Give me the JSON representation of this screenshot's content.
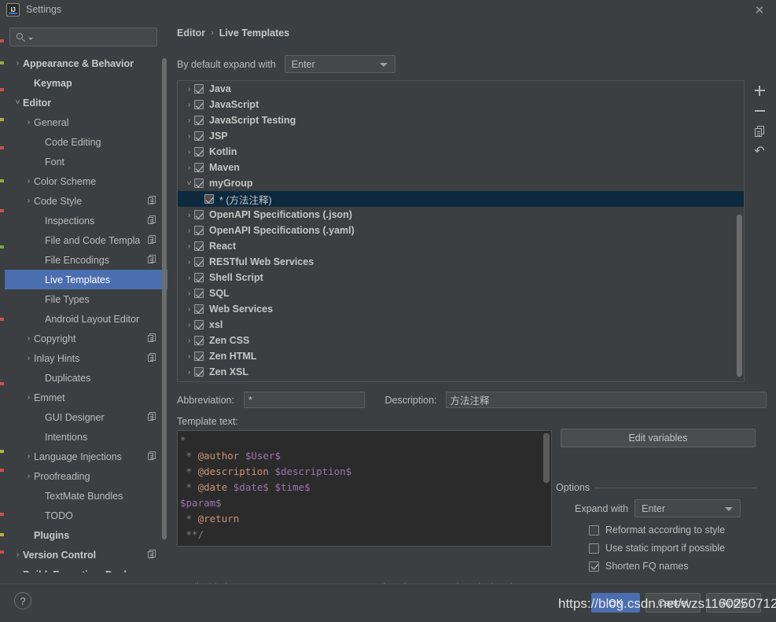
{
  "window": {
    "title": "Settings",
    "logo_text": "IJ",
    "close_icon": "close-icon"
  },
  "sidebar": {
    "search": {
      "placeholder": "",
      "value": "",
      "icon": "search-icon"
    },
    "items": [
      {
        "label": "Appearance & Behavior",
        "arrow": "›",
        "bold": true,
        "indent": 0,
        "copy": false,
        "selected": false
      },
      {
        "label": "Keymap",
        "arrow": "",
        "bold": true,
        "indent": 1,
        "copy": false,
        "selected": false
      },
      {
        "label": "Editor",
        "arrow": "˅",
        "bold": true,
        "indent": 0,
        "copy": false,
        "selected": false
      },
      {
        "label": "General",
        "arrow": "›",
        "bold": false,
        "indent": 1,
        "copy": false,
        "selected": false
      },
      {
        "label": "Code Editing",
        "arrow": "",
        "bold": false,
        "indent": 2,
        "copy": false,
        "selected": false
      },
      {
        "label": "Font",
        "arrow": "",
        "bold": false,
        "indent": 2,
        "copy": false,
        "selected": false
      },
      {
        "label": "Color Scheme",
        "arrow": "›",
        "bold": false,
        "indent": 1,
        "copy": false,
        "selected": false
      },
      {
        "label": "Code Style",
        "arrow": "›",
        "bold": false,
        "indent": 1,
        "copy": true,
        "selected": false
      },
      {
        "label": "Inspections",
        "arrow": "",
        "bold": false,
        "indent": 2,
        "copy": true,
        "selected": false
      },
      {
        "label": "File and Code Templa",
        "arrow": "",
        "bold": false,
        "indent": 2,
        "copy": true,
        "selected": false
      },
      {
        "label": "File Encodings",
        "arrow": "",
        "bold": false,
        "indent": 2,
        "copy": true,
        "selected": false
      },
      {
        "label": "Live Templates",
        "arrow": "",
        "bold": false,
        "indent": 2,
        "copy": false,
        "selected": true
      },
      {
        "label": "File Types",
        "arrow": "",
        "bold": false,
        "indent": 2,
        "copy": false,
        "selected": false
      },
      {
        "label": "Android Layout Editor",
        "arrow": "",
        "bold": false,
        "indent": 2,
        "copy": false,
        "selected": false
      },
      {
        "label": "Copyright",
        "arrow": "›",
        "bold": false,
        "indent": 1,
        "copy": true,
        "selected": false
      },
      {
        "label": "Inlay Hints",
        "arrow": "›",
        "bold": false,
        "indent": 1,
        "copy": true,
        "selected": false
      },
      {
        "label": "Duplicates",
        "arrow": "",
        "bold": false,
        "indent": 2,
        "copy": false,
        "selected": false
      },
      {
        "label": "Emmet",
        "arrow": "›",
        "bold": false,
        "indent": 1,
        "copy": false,
        "selected": false
      },
      {
        "label": "GUI Designer",
        "arrow": "",
        "bold": false,
        "indent": 2,
        "copy": true,
        "selected": false
      },
      {
        "label": "Intentions",
        "arrow": "",
        "bold": false,
        "indent": 2,
        "copy": false,
        "selected": false
      },
      {
        "label": "Language Injections",
        "arrow": "›",
        "bold": false,
        "indent": 1,
        "copy": true,
        "selected": false
      },
      {
        "label": "Proofreading",
        "arrow": "›",
        "bold": false,
        "indent": 1,
        "copy": false,
        "selected": false
      },
      {
        "label": "TextMate Bundles",
        "arrow": "",
        "bold": false,
        "indent": 2,
        "copy": false,
        "selected": false
      },
      {
        "label": "TODO",
        "arrow": "",
        "bold": false,
        "indent": 2,
        "copy": false,
        "selected": false
      },
      {
        "label": "Plugins",
        "arrow": "",
        "bold": true,
        "indent": 1,
        "copy": false,
        "selected": false
      },
      {
        "label": "Version Control",
        "arrow": "›",
        "bold": true,
        "indent": 0,
        "copy": true,
        "selected": false
      },
      {
        "label": "Build, Execution, Deploym",
        "arrow": "›",
        "bold": true,
        "indent": 0,
        "copy": false,
        "selected": false
      }
    ]
  },
  "main": {
    "breadcrumb": {
      "parent": "Editor",
      "separator": "›",
      "current": "Live Templates"
    },
    "expand_row": {
      "label": "By default expand with",
      "value": "Enter"
    },
    "template_groups": [
      {
        "label": "Java",
        "arrow": "›",
        "checked": true,
        "leaf": false,
        "selected": false
      },
      {
        "label": "JavaScript",
        "arrow": "›",
        "checked": true,
        "leaf": false,
        "selected": false
      },
      {
        "label": "JavaScript Testing",
        "arrow": "›",
        "checked": true,
        "leaf": false,
        "selected": false
      },
      {
        "label": "JSP",
        "arrow": "›",
        "checked": true,
        "leaf": false,
        "selected": false
      },
      {
        "label": "Kotlin",
        "arrow": "›",
        "checked": true,
        "leaf": false,
        "selected": false
      },
      {
        "label": "Maven",
        "arrow": "›",
        "checked": true,
        "leaf": false,
        "selected": false
      },
      {
        "label": "myGroup",
        "arrow": "˅",
        "checked": true,
        "leaf": false,
        "selected": false
      },
      {
        "label": "* (方法注释)",
        "arrow": "",
        "checked": true,
        "leaf": true,
        "selected": true
      },
      {
        "label": "OpenAPI Specifications (.json)",
        "arrow": "›",
        "checked": true,
        "leaf": false,
        "selected": false
      },
      {
        "label": "OpenAPI Specifications (.yaml)",
        "arrow": "›",
        "checked": true,
        "leaf": false,
        "selected": false
      },
      {
        "label": "React",
        "arrow": "›",
        "checked": true,
        "leaf": false,
        "selected": false
      },
      {
        "label": "RESTful Web Services",
        "arrow": "›",
        "checked": true,
        "leaf": false,
        "selected": false
      },
      {
        "label": "Shell Script",
        "arrow": "›",
        "checked": true,
        "leaf": false,
        "selected": false
      },
      {
        "label": "SQL",
        "arrow": "›",
        "checked": true,
        "leaf": false,
        "selected": false
      },
      {
        "label": "Web Services",
        "arrow": "›",
        "checked": true,
        "leaf": false,
        "selected": false
      },
      {
        "label": "xsl",
        "arrow": "›",
        "checked": true,
        "leaf": false,
        "selected": false
      },
      {
        "label": "Zen CSS",
        "arrow": "›",
        "checked": true,
        "leaf": false,
        "selected": false
      },
      {
        "label": "Zen HTML",
        "arrow": "›",
        "checked": true,
        "leaf": false,
        "selected": false
      },
      {
        "label": "Zen XSL",
        "arrow": "›",
        "checked": true,
        "leaf": false,
        "selected": false
      }
    ],
    "list_tools": [
      {
        "name": "add-template-button",
        "icon": "plus-icon"
      },
      {
        "name": "remove-template-button",
        "icon": "minus-icon"
      },
      {
        "name": "duplicate-template-button",
        "icon": "duplicate-icon"
      },
      {
        "name": "restore-defaults-button",
        "icon": "undo-icon"
      }
    ],
    "abbreviation": {
      "label": "Abbreviation:",
      "value": "*"
    },
    "description": {
      "label": "Description:",
      "value": "方法注释"
    },
    "template_text_label": "Template text:",
    "template_text_lines": [
      "*",
      " * @author $User$",
      " * @description $description$",
      " * @date $date$ $time$",
      "$param$",
      " * @return",
      " **/"
    ],
    "edit_variables_label": "Edit variables",
    "options": {
      "title": "Options",
      "expand_with": {
        "label": "Expand with",
        "value": "Enter"
      },
      "checkboxes": [
        {
          "label": "Reformat according to style",
          "checked": false
        },
        {
          "label": "Use static import if possible",
          "checked": false
        },
        {
          "label": "Shorten FQ names",
          "checked": true
        }
      ]
    },
    "applicable": "Applicable in Java; Java: statement, consumer function, expression, declaration, co"
  },
  "footer": {
    "help_label": "?",
    "ok_label": "OK",
    "cancel_label": "Cancel",
    "apply_label": "Apply",
    "watermark": "https://blog.csdn.net/wzs1160250712"
  },
  "colors": {
    "background": "#3c3f41",
    "selection_blue": "#4b6eaf",
    "list_selection": "#0d293e",
    "editor_bg": "#2b2b2b",
    "variable": "#9876aa",
    "doc_tag": "#ce9178"
  }
}
